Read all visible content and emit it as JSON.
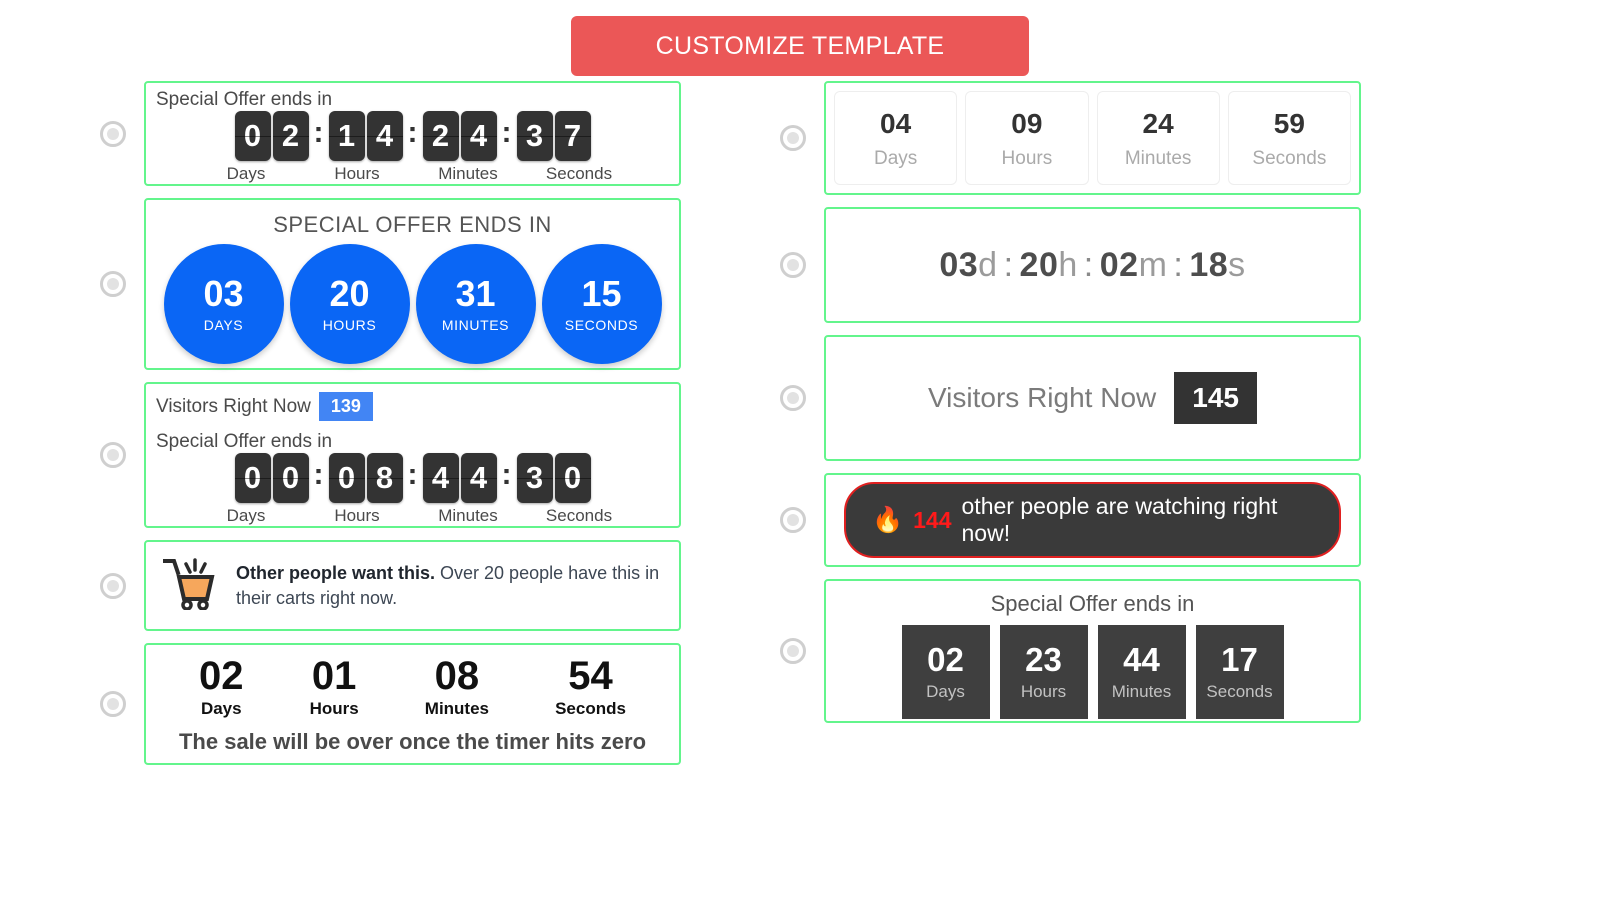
{
  "toolbar": {
    "customize_label": "CUSTOMIZE TEMPLATE",
    "accent_color": "#eb5757"
  },
  "theme": {
    "card_border": "#63f58c",
    "blue_circle": "#0a66f5",
    "dark_tile": "#333333",
    "badge_blue": "#4285f4",
    "alert_red": "#e02020"
  },
  "left_column": [
    {
      "name": "flip-clock-basic",
      "title": "Special Offer ends in",
      "digits": [
        "0",
        "2",
        "1",
        "4",
        "2",
        "4",
        "3",
        "7"
      ],
      "separator": ":",
      "labels": [
        "Days",
        "Hours",
        "Minutes",
        "Seconds"
      ]
    },
    {
      "name": "blue-circles",
      "title": "SPECIAL OFFER ENDS IN",
      "units": [
        {
          "value": "03",
          "label": "DAYS"
        },
        {
          "value": "20",
          "label": "HOURS"
        },
        {
          "value": "31",
          "label": "MINUTES"
        },
        {
          "value": "15",
          "label": "SECONDS"
        }
      ]
    },
    {
      "name": "visitors-plus-flip",
      "visitors_label": "Visitors Right Now",
      "visitors_count": "139",
      "title": "Special Offer ends in",
      "digits": [
        "0",
        "0",
        "0",
        "8",
        "4",
        "4",
        "3",
        "0"
      ],
      "separator": ":",
      "labels": [
        "Days",
        "Hours",
        "Minutes",
        "Seconds"
      ]
    },
    {
      "name": "cart-social-proof",
      "icon": "shopping-cart-icon",
      "bold_text": "Other people want this.",
      "rest_text": " Over 20 people have this in their carts right now."
    },
    {
      "name": "bold-numeric",
      "units": [
        {
          "value": "02",
          "label": "Days"
        },
        {
          "value": "01",
          "label": "Hours"
        },
        {
          "value": "08",
          "label": "Minutes"
        },
        {
          "value": "54",
          "label": "Seconds"
        }
      ],
      "footer": "The sale will be over once the timer hits zero"
    }
  ],
  "right_column": [
    {
      "name": "boxed-cells",
      "units": [
        {
          "value": "04",
          "label": "Days"
        },
        {
          "value": "09",
          "label": "Hours"
        },
        {
          "value": "24",
          "label": "Minutes"
        },
        {
          "value": "59",
          "label": "Seconds"
        }
      ]
    },
    {
      "name": "inline-dhms",
      "parts": [
        {
          "value": "03",
          "unit": "d"
        },
        {
          "value": "20",
          "unit": "h"
        },
        {
          "value": "02",
          "unit": "m"
        },
        {
          "value": "18",
          "unit": "s"
        }
      ],
      "separator": ":"
    },
    {
      "name": "visitors-dark-badge",
      "label": "Visitors Right Now",
      "count": "145"
    },
    {
      "name": "watching-pill",
      "icon": "flame-icon",
      "flame": "🔥",
      "count": "144",
      "message": "other people are watching right now!"
    },
    {
      "name": "dark-boxes",
      "title": "Special Offer ends in",
      "units": [
        {
          "value": "02",
          "label": "Days"
        },
        {
          "value": "23",
          "label": "Hours"
        },
        {
          "value": "44",
          "label": "Minutes"
        },
        {
          "value": "17",
          "label": "Seconds"
        }
      ]
    }
  ]
}
